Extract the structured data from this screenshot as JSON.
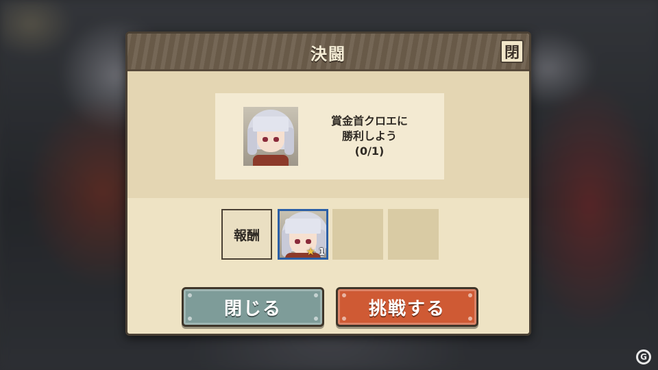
{
  "dialog": {
    "title": "決闘",
    "close_icon_label": "閉"
  },
  "mission": {
    "line1": "賞金首クロエに",
    "line2": "勝利しよう",
    "progress": "(0/1)",
    "portrait_icon": "character-chloe-portrait"
  },
  "reward": {
    "label": "報酬",
    "items": [
      {
        "icon": "character-chloe-portrait",
        "stars": 1,
        "star_label": "1"
      },
      {
        "icon": "empty-slot"
      },
      {
        "icon": "empty-slot"
      }
    ]
  },
  "buttons": {
    "close_label": "閉じる",
    "challenge_label": "挑戦する"
  },
  "colors": {
    "title_bar": "#6e5f4d",
    "panel": "#eee3c4",
    "close_button": "#7e9c99",
    "challenge_button": "#cf5a34",
    "selected_slot_border": "#2b5fa6"
  }
}
